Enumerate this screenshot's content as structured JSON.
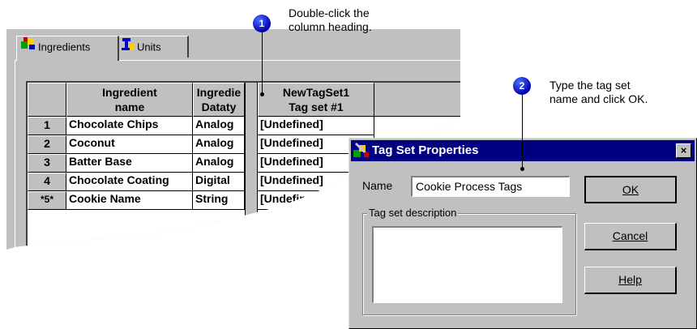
{
  "tabs": [
    {
      "label": "Ingredients",
      "icon": "ingredients-icon"
    },
    {
      "label": "Units",
      "icon": "units-icon"
    }
  ],
  "grid": {
    "headers": {
      "corner": "",
      "col1_line1": "Ingredient",
      "col1_line2": "name",
      "col2_line1": "Ingredie",
      "col2_line2": "Dataty",
      "col3_line1": "NewTagSet1",
      "col3_line2": "Tag set #1"
    },
    "rows": [
      {
        "num": "1",
        "name": "Chocolate Chips",
        "type": "Analog",
        "tag": "[Undefined]"
      },
      {
        "num": "2",
        "name": "Coconut",
        "type": "Analog",
        "tag": "[Undefined]"
      },
      {
        "num": "3",
        "name": "Batter Base",
        "type": "Analog",
        "tag": "[Undefined]"
      },
      {
        "num": "4",
        "name": "Chocolate Coating",
        "type": "Digital",
        "tag": "[Undefined]"
      },
      {
        "num": "*5*",
        "name": "Cookie Name",
        "type": "String",
        "tag": "[Undefined]"
      }
    ]
  },
  "callouts": [
    {
      "num": "1",
      "text_line1": "Double-click the",
      "text_line2": "column heading."
    },
    {
      "num": "2",
      "text_line1": "Type the tag set",
      "text_line2": "name and click OK."
    }
  ],
  "dialog": {
    "title": "Tag Set Properties",
    "close": "×",
    "name_label": "Name",
    "name_value": "Cookie Process Tags",
    "description_label": "Tag set description",
    "description_value": "",
    "ok": "OK",
    "cancel": "Cancel",
    "help": "Help"
  }
}
